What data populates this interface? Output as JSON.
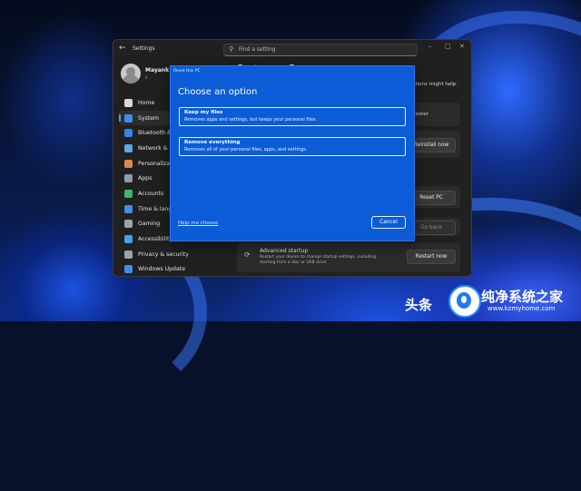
{
  "window": {
    "app_title": "Settings",
    "search_placeholder": "Find a setting"
  },
  "profile": {
    "name": "Mayank P",
    "sub": "h"
  },
  "nav": [
    {
      "label": "Home",
      "icon": "home-icon",
      "color": "#d9d9d9",
      "active": false
    },
    {
      "label": "System",
      "icon": "system-icon",
      "color": "#3f8fe6",
      "active": true
    },
    {
      "label": "Bluetooth & d",
      "icon": "bluetooth-icon",
      "color": "#2f87e8",
      "active": false
    },
    {
      "label": "Network & int",
      "icon": "network-icon",
      "color": "#5aa9ea",
      "active": false
    },
    {
      "label": "Personalizati",
      "icon": "personalization-icon",
      "color": "#d88a4e",
      "active": false
    },
    {
      "label": "Apps",
      "icon": "apps-icon",
      "color": "#8e9cb0",
      "active": false
    },
    {
      "label": "Accounts",
      "icon": "accounts-icon",
      "color": "#43b46b",
      "active": false
    },
    {
      "label": "Time & langua",
      "icon": "time-language-icon",
      "color": "#3f8fe6",
      "active": false
    },
    {
      "label": "Gaming",
      "icon": "gaming-icon",
      "color": "#9aa3ad",
      "active": false
    },
    {
      "label": "Accessibility",
      "icon": "accessibility-icon",
      "color": "#4c9be8",
      "active": false
    },
    {
      "label": "Privacy & security",
      "icon": "privacy-security-icon",
      "color": "#9aa3ad",
      "active": false
    },
    {
      "label": "Windows Update",
      "icon": "windows-update-icon",
      "color": "#3f8fe6",
      "active": false
    }
  ],
  "main": {
    "heading": "System  >  Recovery",
    "partial_help_text": "ptions might help.",
    "troubleshooter_text": "hooter",
    "reinstall_button": "Reinstall now",
    "reset_button": "Reset PC",
    "go_back_button": "Go back",
    "advanced_startup": {
      "title": "Advanced startup",
      "description": "Restart your device to change startup settings, including starting from a disc or USB drive",
      "button": "Restart now"
    }
  },
  "dialog": {
    "caption": "Reset this PC",
    "heading": "Choose an option",
    "options": [
      {
        "title": "Keep my files",
        "description": "Removes apps and settings, but keeps your personal files."
      },
      {
        "title": "Remove everything",
        "description": "Removes all of your personal files, apps, and settings."
      }
    ],
    "help_link": "Help me choose",
    "cancel": "Cancel"
  },
  "watermark": {
    "left_text": "头条",
    "title": "纯净系统之家",
    "url": "www.kzmyhome.com"
  }
}
